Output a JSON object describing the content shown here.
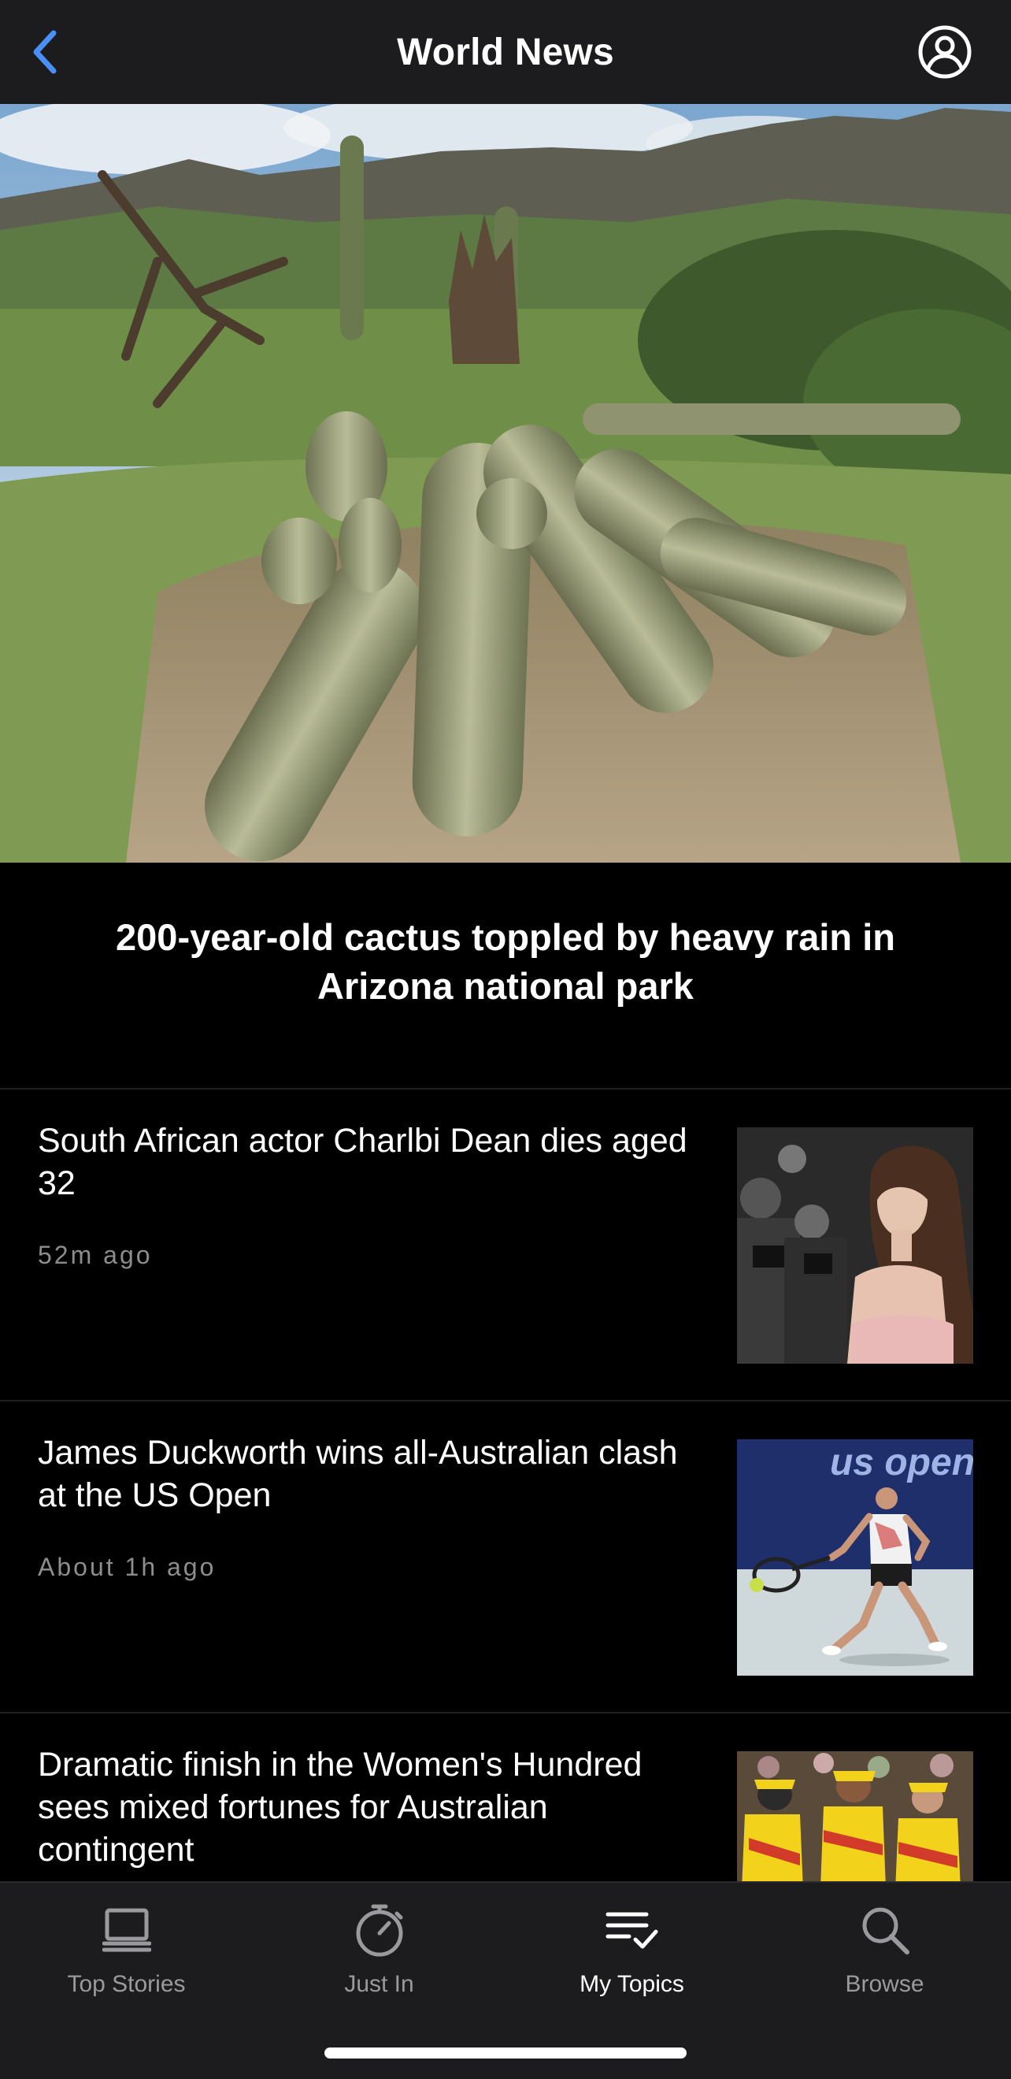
{
  "nav": {
    "back_icon": "chevron-left-icon",
    "title": "World News",
    "account_icon": "user-circle-icon",
    "accent_color": "#4a8ff5"
  },
  "hero": {
    "image": "toppled-saguaro-cactus-photo",
    "title": "200-year-old cactus toppled by heavy rain in Arizona national park"
  },
  "articles": [
    {
      "title": "South African actor Charlbi Dean dies aged 32",
      "time": "52m ago",
      "thumbnail": "red-carpet-actor-photo"
    },
    {
      "title": "James Duckworth wins all-Australian clash at the US Open",
      "time": "About 1h ago",
      "thumbnail": "tennis-player-us-open-photo",
      "thumbnail_text": "us open"
    },
    {
      "title": "Dramatic finish in the Women's Hundred sees mixed fortunes for Australian contingent",
      "time": "",
      "thumbnail": "cricket-players-celebrating-photo"
    }
  ],
  "tabs": [
    {
      "label": "Top Stories",
      "icon": "laptop-icon",
      "active": false
    },
    {
      "label": "Just In",
      "icon": "stopwatch-icon",
      "active": false
    },
    {
      "label": "My Topics",
      "icon": "list-check-icon",
      "active": true
    },
    {
      "label": "Browse",
      "icon": "search-icon",
      "active": false
    }
  ]
}
